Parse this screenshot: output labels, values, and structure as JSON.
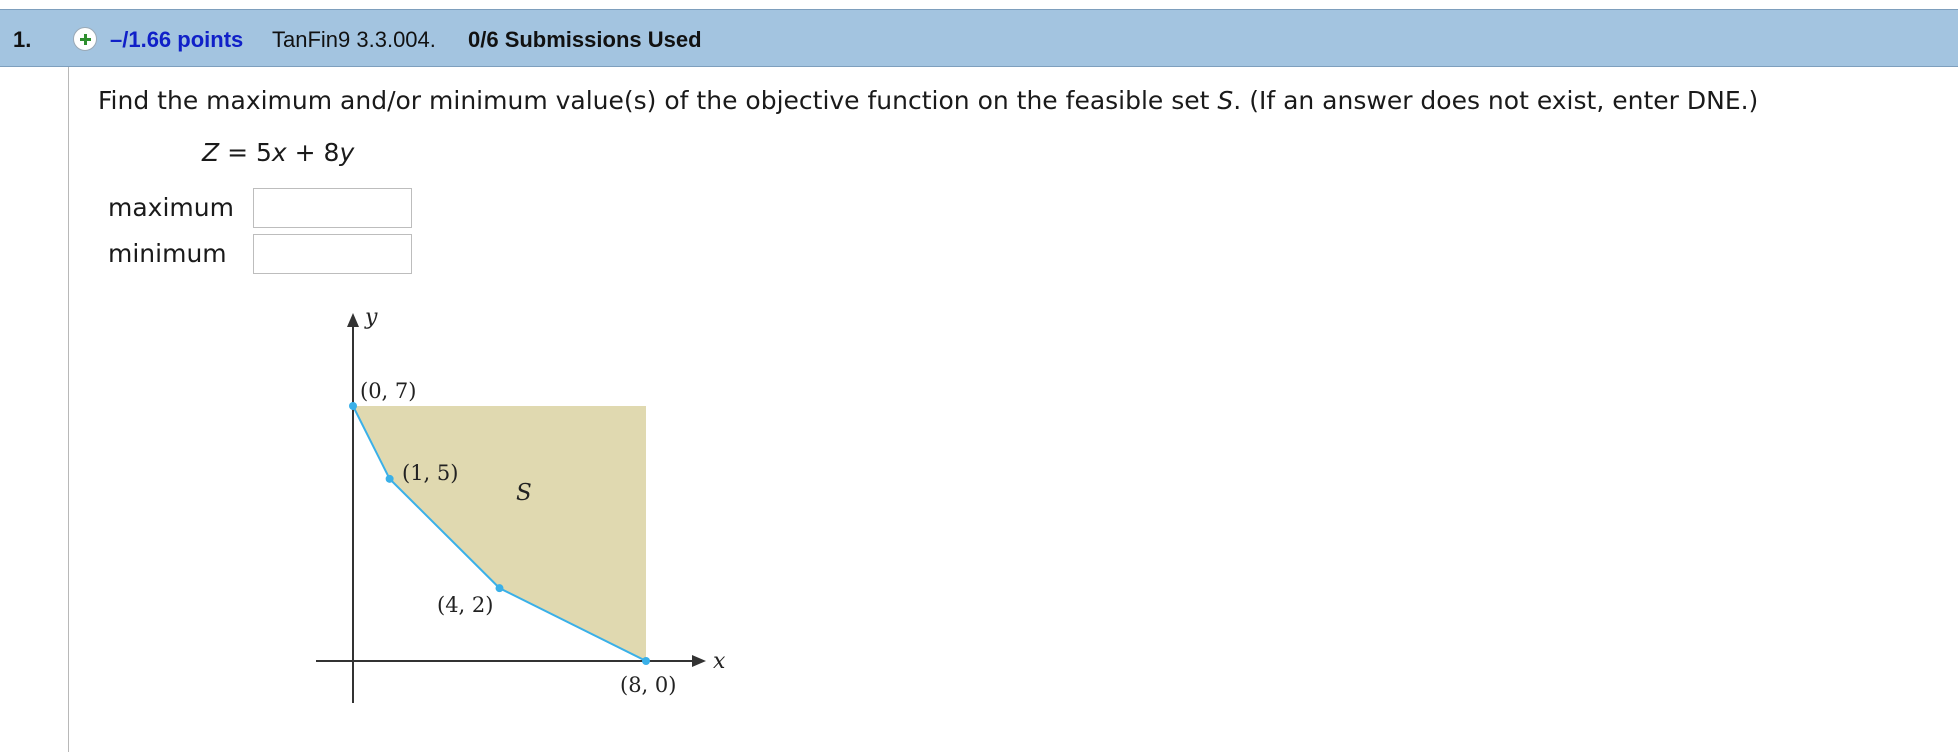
{
  "header": {
    "question_number": "1.",
    "points": "–/1.66 points",
    "source": "TanFin9 3.3.004.",
    "submissions": "0/6 Submissions Used",
    "icon": "plus-circle-icon",
    "background": "#a3c4e0",
    "points_color": "#1020c8"
  },
  "question": {
    "text_before": "Find the maximum and/or minimum value(s) of the objective function on the feasible set ",
    "set_name": "S",
    "text_after": ". (If an answer does not exist, enter DNE.)",
    "formula": {
      "lhs": "Z",
      "eq": " = 5",
      "var1": "x",
      "plus": " + 8",
      "var2": "y"
    }
  },
  "answers": {
    "maximum_label": "maximum",
    "maximum_value": "",
    "minimum_label": "minimum",
    "minimum_value": ""
  },
  "figure": {
    "x_axis_label": "x",
    "y_axis_label": "y",
    "region_label": "S",
    "region_color": "#e0d9b0",
    "boundary_color": "#3ab0e8",
    "vertices": [
      {
        "label": "(0, 7)",
        "x": 0,
        "y": 7
      },
      {
        "label": "(1, 5)",
        "x": 1,
        "y": 5
      },
      {
        "label": "(4, 2)",
        "x": 4,
        "y": 2
      },
      {
        "label": "(8, 0)",
        "x": 8,
        "y": 0
      }
    ]
  }
}
